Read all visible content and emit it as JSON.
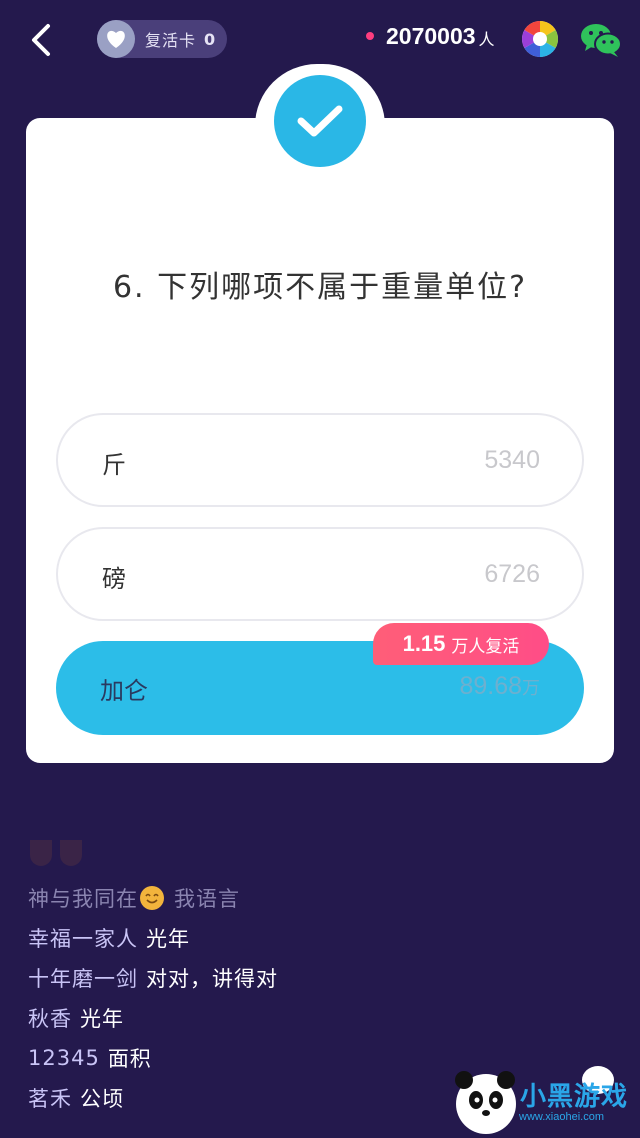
{
  "topbar": {
    "revive_card_label": "复活卡",
    "revive_card_count": "0",
    "online_count": "2070003",
    "online_unit": "人"
  },
  "question": {
    "text": "6. 下列哪项不属于重量单位?"
  },
  "options": [
    {
      "text": "斤",
      "count": "5340"
    },
    {
      "text": "磅",
      "count": "6726"
    },
    {
      "text": "加仑",
      "count": "89.68",
      "count_unit": "万",
      "correct": true
    }
  ],
  "revive_tag": {
    "number": "1.15",
    "suffix": "万人复活"
  },
  "comments": [
    {
      "user": "神与我同在",
      "emoji": "smile",
      "msg": "我语言",
      "faded": true
    },
    {
      "user": "幸福一家人",
      "msg": "光年"
    },
    {
      "user": "十年磨一剑",
      "msg": "对对，讲得对"
    },
    {
      "user": "秋香",
      "msg": "光年"
    },
    {
      "user": "12345",
      "msg": "面积"
    },
    {
      "user": "茗禾",
      "msg": "公顷"
    }
  ],
  "watermark": {
    "text": "小黑游戏",
    "sub": "www.xiaohei.com"
  },
  "colors": {
    "background": "#24194d",
    "accent": "#2cbde8",
    "revive_tag": "#ff5e78",
    "online_dot": "#ff3d7f"
  }
}
